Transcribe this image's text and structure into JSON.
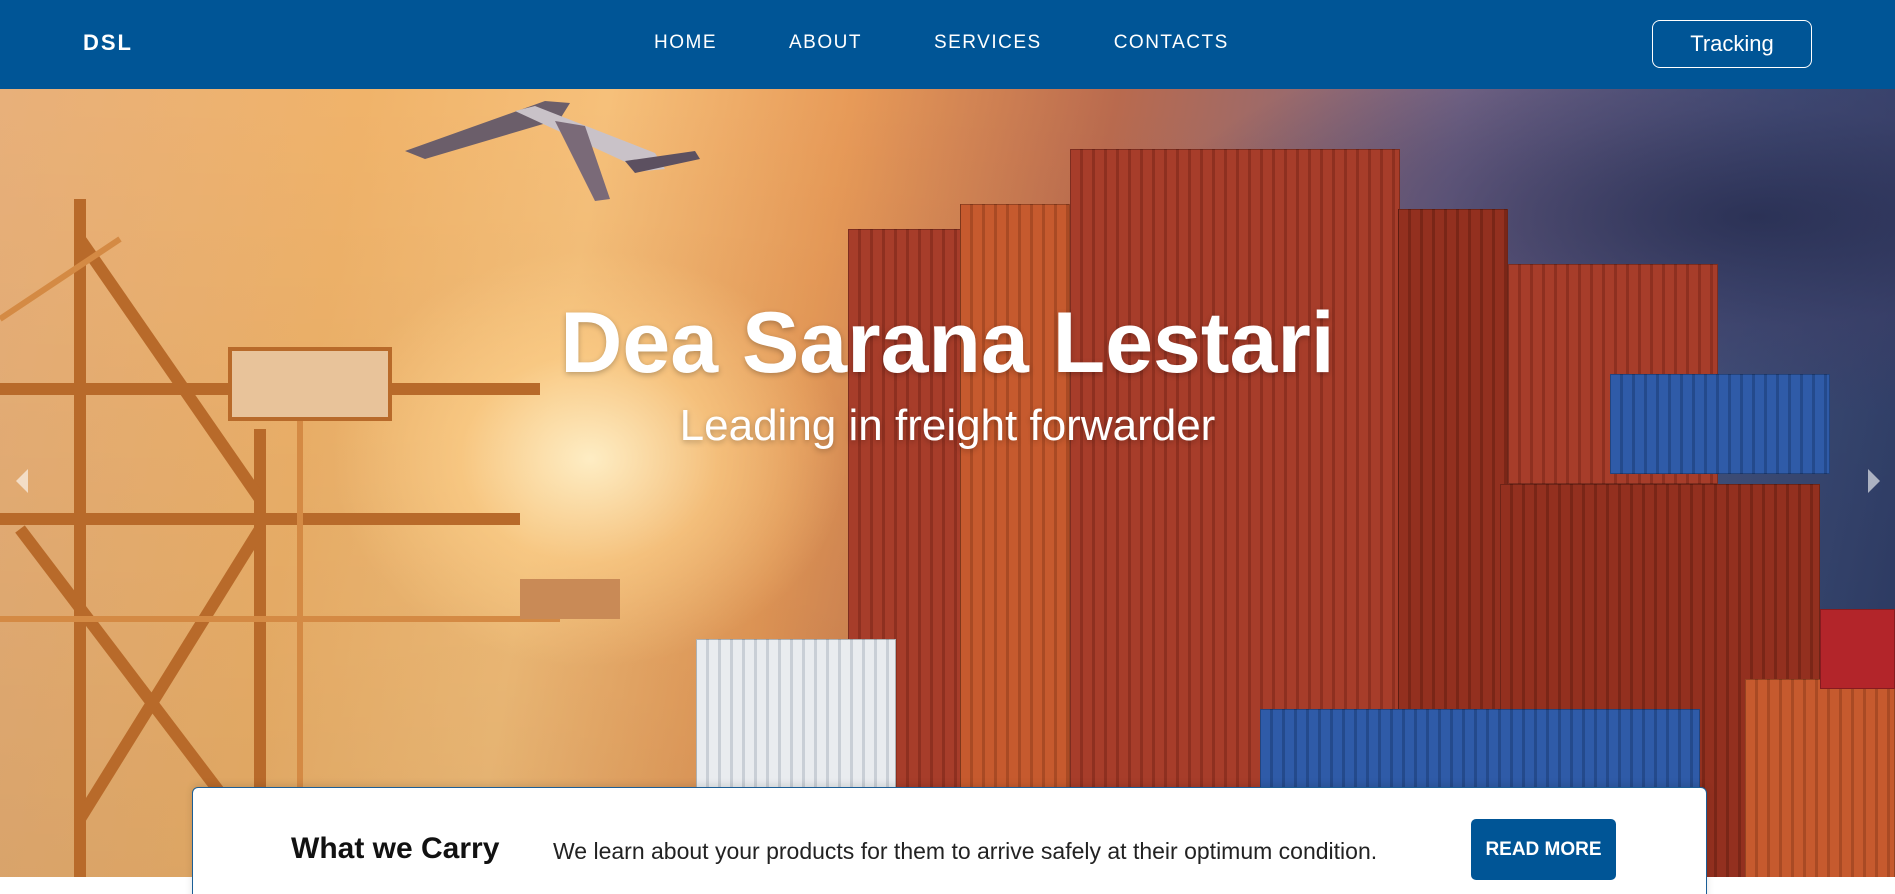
{
  "navbar": {
    "brand": "DSL",
    "links": [
      {
        "label": "HOME"
      },
      {
        "label": "ABOUT"
      },
      {
        "label": "SERVICES"
      },
      {
        "label": "CONTACTS"
      }
    ],
    "tracking_label": "Tracking",
    "bg_color": "#005596"
  },
  "hero": {
    "title": "Dea Sarana Lestari",
    "subtitle": "Leading in freight forwarder"
  },
  "carry": {
    "title": "What we Carry",
    "text": "We learn about your products for them to arrive safely at their optimum condition.",
    "button_label": "READ MORE"
  }
}
